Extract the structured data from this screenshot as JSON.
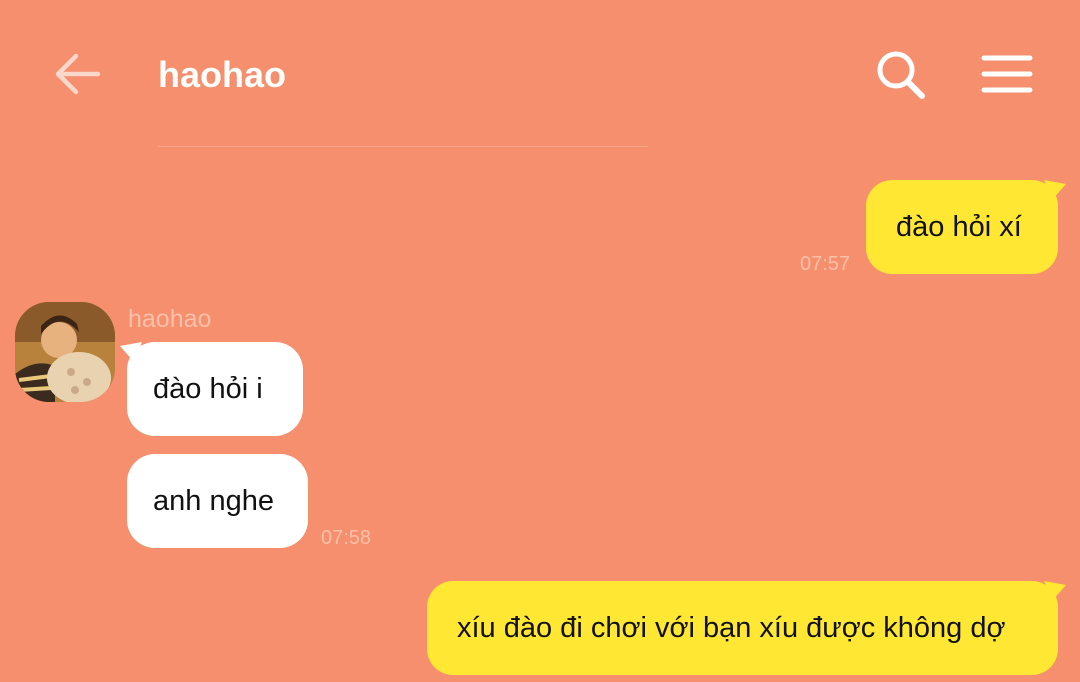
{
  "header": {
    "title": "haohao",
    "back_icon": "arrow-left-icon",
    "search_icon": "search-icon",
    "menu_icon": "hamburger-menu-icon"
  },
  "colors": {
    "background": "#f58f6d",
    "my_bubble": "#ffe733",
    "their_bubble": "#ffffff",
    "text": "#111111",
    "timestamp": "#fcc0a8"
  },
  "messages": [
    {
      "side": "me",
      "text": "đào hỏi xí",
      "time": "07:57"
    },
    {
      "side": "them",
      "sender": "haohao",
      "text": "đào hỏi i"
    },
    {
      "side": "them",
      "text": "anh nghe",
      "time": "07:58"
    },
    {
      "side": "me",
      "text": "xíu đào đi chơi với bạn xíu được không dợ"
    }
  ]
}
